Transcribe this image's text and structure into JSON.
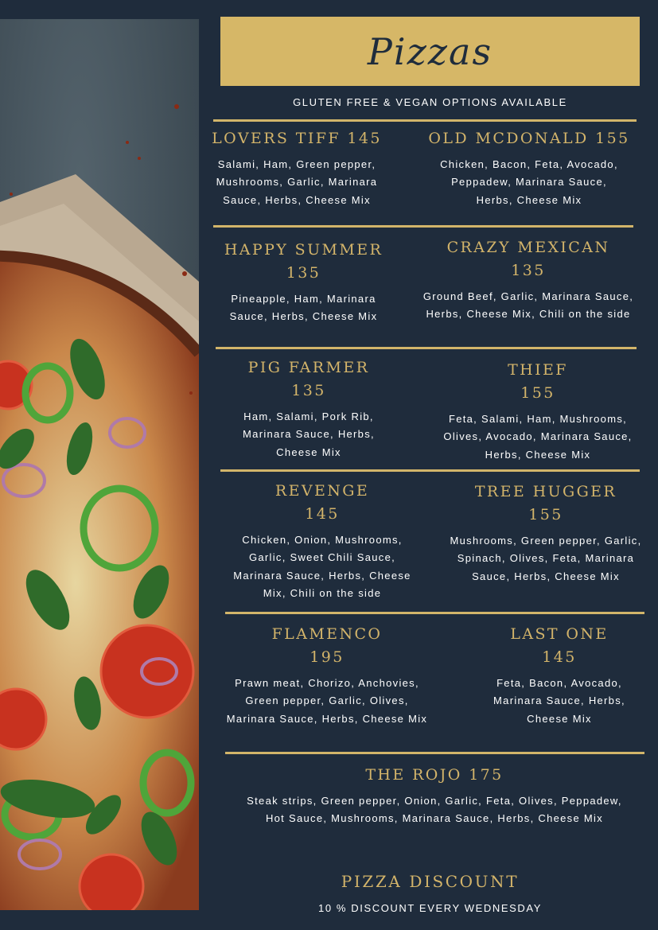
{
  "header": {
    "title": "Pizzas",
    "subtitle": "GLUTEN FREE & VEGAN OPTIONS AVAILABLE"
  },
  "menu": [
    {
      "name": "LOVERS TIFF 145",
      "price": "",
      "description": "Salami, Ham, Green pepper, Mushrooms, Garlic, Marinara Sauce, Herbs, Cheese Mix"
    },
    {
      "name": "OLD MCDONALD 155",
      "price": "",
      "description": "Chicken, Bacon, Feta, Avocado, Peppadew, Marinara Sauce, Herbs, Cheese Mix"
    },
    {
      "name": "HAPPY SUMMER",
      "price": "135",
      "description": "Pineapple, Ham, Marinara Sauce, Herbs, Cheese Mix"
    },
    {
      "name": "CRAZY MEXICAN",
      "price": "135",
      "description": "Ground Beef, Garlic, Marinara Sauce, Herbs, Cheese Mix, Chili on the side"
    },
    {
      "name": "PIG FARMER",
      "price": "135",
      "description": "Ham, Salami, Pork Rib, Marinara Sauce, Herbs, Cheese Mix"
    },
    {
      "name": "THIEF",
      "price": "155",
      "description": "Feta, Salami, Ham, Mushrooms, Olives, Avocado, Marinara Sauce, Herbs, Cheese Mix"
    },
    {
      "name": "REVENGE",
      "price": "145",
      "description": "Chicken, Onion, Mushrooms, Garlic, Sweet Chili Sauce, Marinara Sauce, Herbs, Cheese Mix, Chili on the side"
    },
    {
      "name": "TREE HUGGER",
      "price": "155",
      "description": "Mushrooms, Green pepper, Garlic, Spinach, Olives, Feta, Marinara Sauce, Herbs, Cheese Mix"
    },
    {
      "name": "FLAMENCO",
      "price": "195",
      "description": "Prawn meat, Chorizo, Anchovies, Green pepper, Garlic, Olives, Marinara Sauce, Herbs, Cheese Mix"
    },
    {
      "name": "LAST ONE",
      "price": "145",
      "description": "Feta, Bacon, Avocado, Marinara Sauce, Herbs, Cheese Mix"
    },
    {
      "name": "THE ROJO 175",
      "price": "",
      "description": "Steak strips, Green pepper, Onion, Garlic, Feta, Olives, Peppadew, Hot Sauce, Mushrooms, Marinara Sauce, Herbs, Cheese Mix"
    }
  ],
  "footer": {
    "title": "PIZZA DISCOUNT",
    "text": "10 % DISCOUNT EVERY WEDNESDAY"
  },
  "colors": {
    "background": "#1f2c3c",
    "accent_gold": "#d6b767",
    "text": "#ffffff"
  }
}
